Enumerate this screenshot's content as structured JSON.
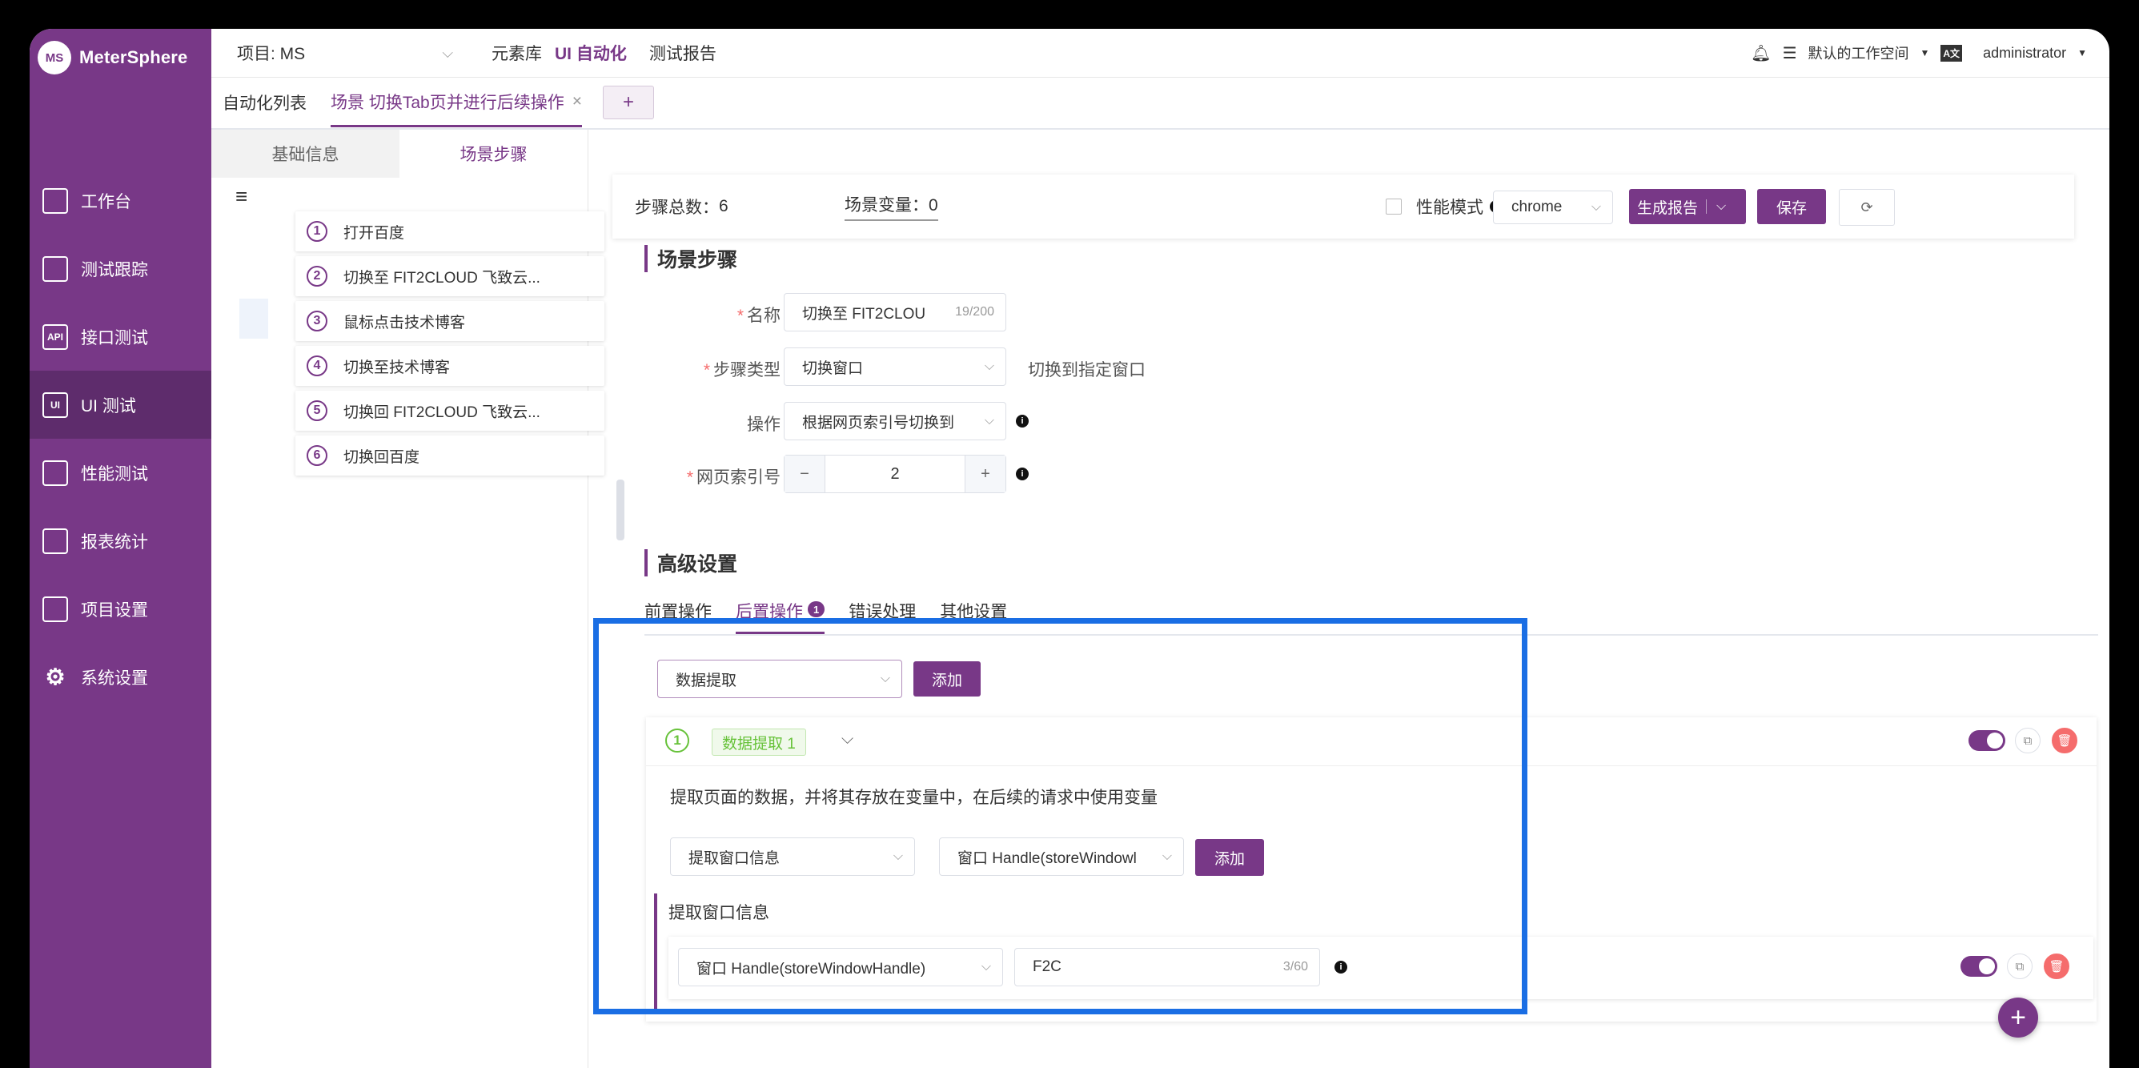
{
  "app": {
    "brand": "MeterSphere",
    "logo_text": "MS"
  },
  "topbar": {
    "project_label": "项目: MS",
    "menus": [
      "元素库",
      "UI 自动化",
      "测试报告"
    ],
    "workspace": "默认的工作空间",
    "lang_badge": "A文",
    "user": "administrator"
  },
  "sidebar": {
    "items": [
      {
        "label": "工作台",
        "icon": "monitor-icon"
      },
      {
        "label": "测试跟踪",
        "icon": "clipboard-icon"
      },
      {
        "label": "接口测试",
        "icon": "api-icon"
      },
      {
        "label": "UI 测试",
        "icon": "ui-icon",
        "active": true
      },
      {
        "label": "性能测试",
        "icon": "chart-icon"
      },
      {
        "label": "报表统计",
        "icon": "report-icon"
      },
      {
        "label": "项目设置",
        "icon": "folder-icon"
      },
      {
        "label": "系统设置",
        "icon": "gear-icon"
      }
    ],
    "icon_text": {
      "api": "API",
      "ui": "UI"
    }
  },
  "tabs": {
    "list_tab": "自动化列表",
    "scene_tab": "场景 切换Tab页并进行后续操作",
    "close": "×",
    "add": "+"
  },
  "left_panel": {
    "tab_basic": "基础信息",
    "tab_steps": "场景步骤",
    "menu_icon": "≡",
    "steps": [
      {
        "n": "1",
        "label": "打开百度"
      },
      {
        "n": "2",
        "label": "切换至 FIT2CLOUD 飞致云..."
      },
      {
        "n": "3",
        "label": "鼠标点击技术博客"
      },
      {
        "n": "4",
        "label": "切换至技术博客"
      },
      {
        "n": "5",
        "label": "切换回 FIT2CLOUD 飞致云..."
      },
      {
        "n": "6",
        "label": "切换回百度"
      }
    ]
  },
  "toolbar": {
    "step_total_label": "步骤总数：",
    "step_total": "6",
    "scene_var_label": "场景变量：",
    "scene_var": "0",
    "perf_mode": "性能模式",
    "browser": "chrome",
    "report_btn": "生成报告",
    "save_btn": "保存",
    "refresh_icon": "⟳",
    "info": "i"
  },
  "step_form": {
    "title": "场景步骤",
    "name_label": "名称",
    "name_value": "切换至 FIT2CLOU",
    "name_count": "19/200",
    "type_label": "步骤类型",
    "type_value": "切换窗口",
    "type_hint": "切换到指定窗口",
    "op_label": "操作",
    "op_value": "根据网页索引号切换到",
    "index_label": "网页索引号",
    "index_value": "2",
    "minus": "−",
    "plus": "+"
  },
  "advanced": {
    "title": "高级设置",
    "tabs": [
      "前置操作",
      "后置操作",
      "错误处理",
      "其他设置"
    ],
    "post_count": "1",
    "extract_select": "数据提取",
    "add_btn": "添加",
    "card": {
      "index": "1",
      "tag": "数据提取 1",
      "desc": "提取页面的数据，并将其存放在变量中，在后续的请求中使用变量",
      "type_select": "提取窗口信息",
      "handle_select": "窗口 Handle(storeWindowl",
      "add_btn": "添加",
      "group_title": "提取窗口信息",
      "row_select": "窗口 Handle(storeWindowHandle)",
      "row_value": "F2C",
      "row_count": "3/60"
    },
    "fab": "+"
  },
  "colors": {
    "brand": "#783887",
    "highlight": "#1a6ee4",
    "success": "#67c23a",
    "danger": "#f56c6c"
  }
}
